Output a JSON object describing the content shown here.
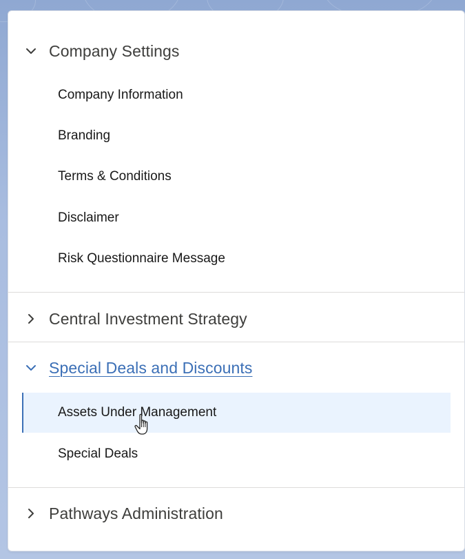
{
  "sections": [
    {
      "title": "Company Settings",
      "expanded": true,
      "items": [
        {
          "label": "Company Information"
        },
        {
          "label": "Branding"
        },
        {
          "label": "Terms & Conditions"
        },
        {
          "label": "Disclaimer"
        },
        {
          "label": "Risk Questionnaire Message"
        }
      ]
    },
    {
      "title": "Central Investment Strategy",
      "expanded": false,
      "items": []
    },
    {
      "title": "Special Deals and Discounts",
      "expanded": true,
      "active": true,
      "items": [
        {
          "label": "Assets Under Management",
          "selected": true
        },
        {
          "label": "Special Deals"
        }
      ]
    },
    {
      "title": "Pathways Administration",
      "expanded": false,
      "items": []
    }
  ],
  "icons": {
    "expanded": "chevron-down-icon",
    "collapsed": "chevron-right-icon",
    "cursor": "hand-pointer-cursor-icon"
  },
  "colors": {
    "accent": "#3b6fb6",
    "selected_bg": "#eaf3fe",
    "text": "#3e3e3c",
    "divider": "#dddbda"
  }
}
